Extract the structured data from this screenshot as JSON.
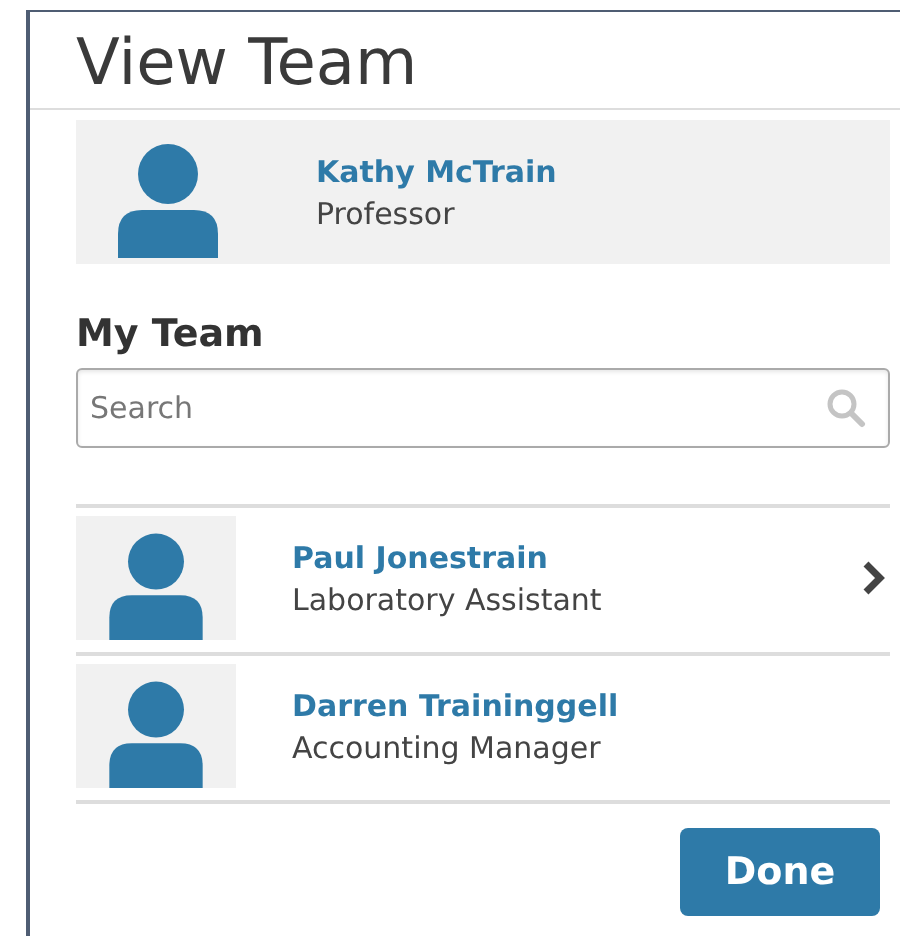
{
  "title": "View Team",
  "me": {
    "name": "Kathy McTrain",
    "role": "Professor"
  },
  "team_heading": "My Team",
  "search": {
    "placeholder": "Search"
  },
  "members": [
    {
      "name": "Paul Jonestrain",
      "role": "Laboratory Assistant",
      "navigable": true
    },
    {
      "name": "Darren Traininggell",
      "role": "Accounting Manager",
      "navigable": false
    }
  ],
  "buttons": [
    "Done"
  ]
}
